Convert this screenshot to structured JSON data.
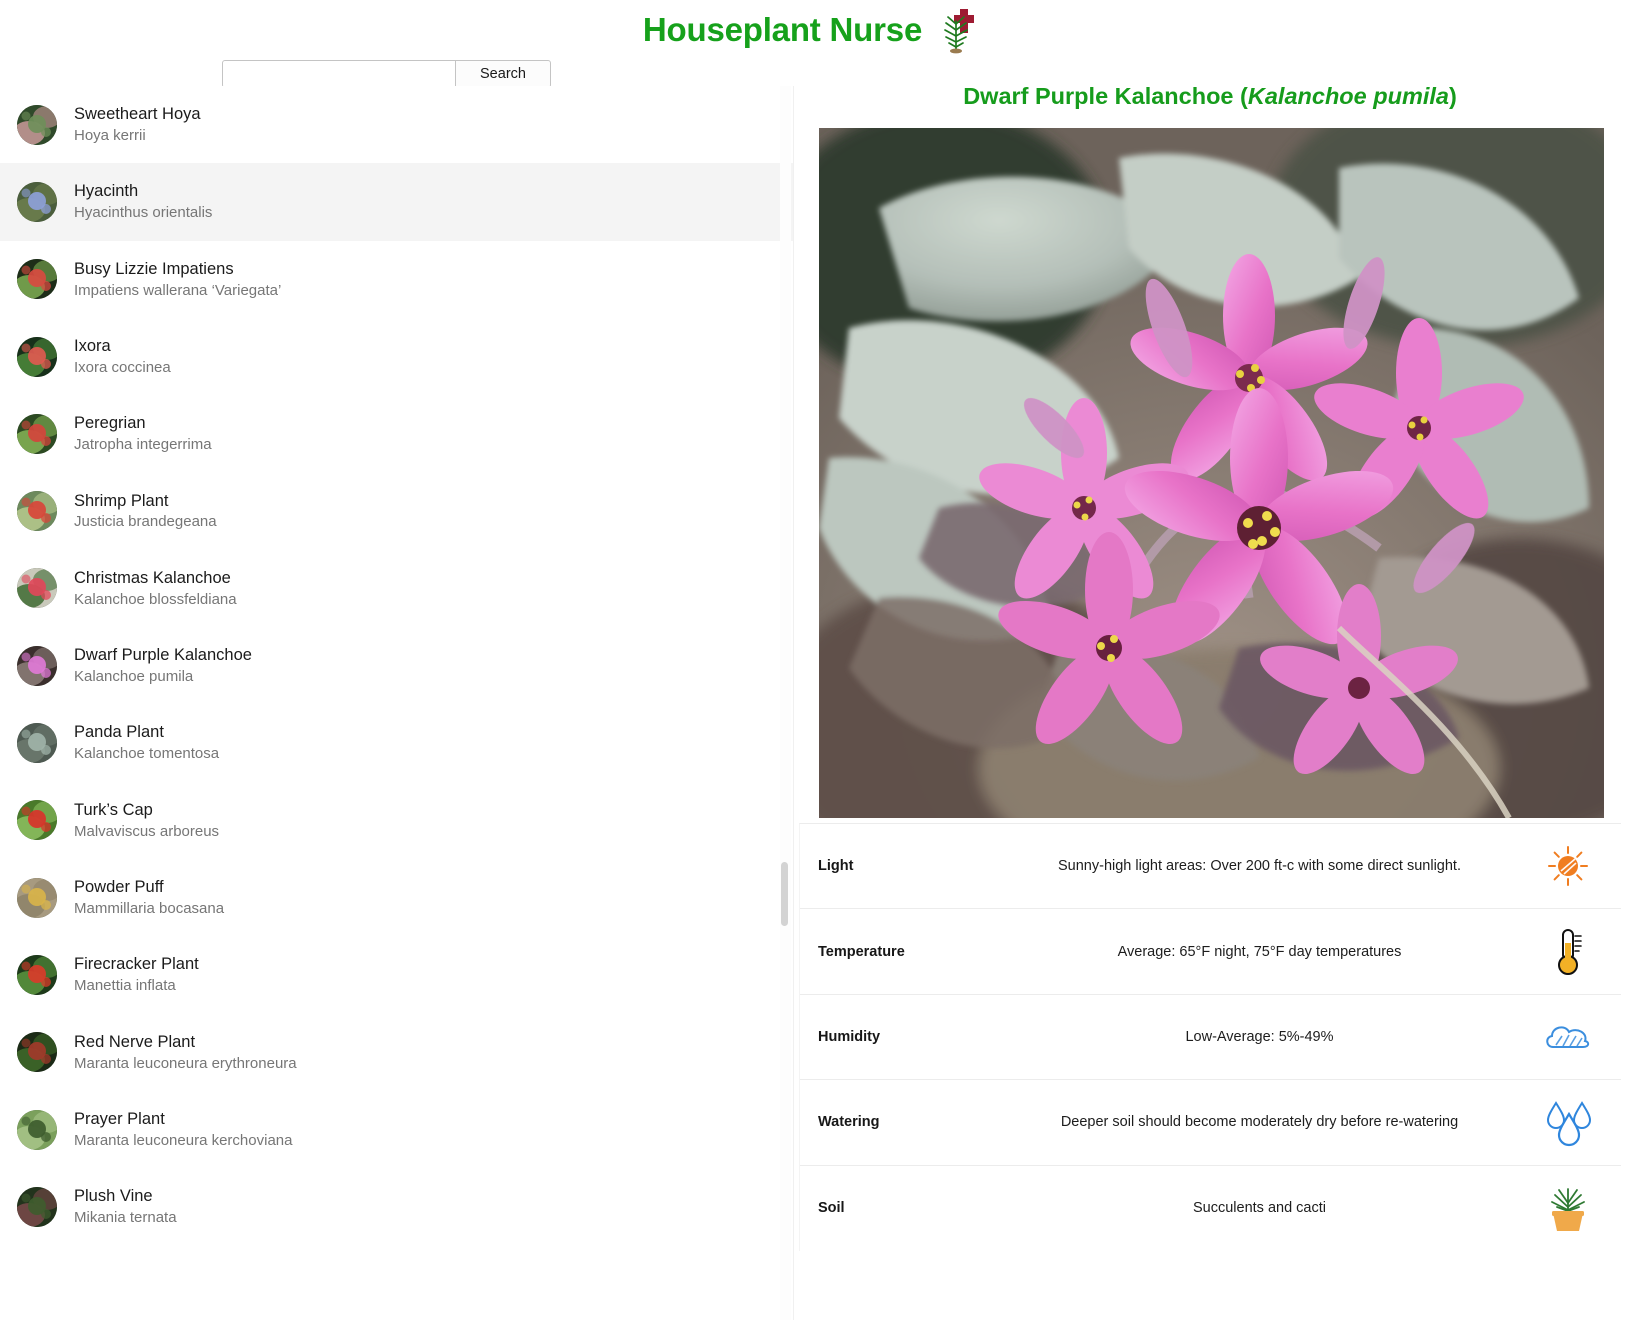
{
  "app": {
    "title": "Houseplant Nurse",
    "logo_icon": "plant-with-medical-cross-icon",
    "accent_color": "#16a11b",
    "cross_color": "#9e1b32"
  },
  "search": {
    "value": "",
    "placeholder": "",
    "button_label": "Search",
    "icon": "search-icon"
  },
  "plant_list": {
    "selected_index": 1,
    "items": [
      {
        "common_name": "Sweetheart Hoya",
        "scientific_name": "Hoya kerrii",
        "thumb_colors": [
          "#2f4a2a",
          "#6f8f5a",
          "#c99a9a"
        ]
      },
      {
        "common_name": "Hyacinth",
        "scientific_name": "Hyacinthus orientalis",
        "thumb_colors": [
          "#4b5e3c",
          "#8da0d8",
          "#6d7f4d"
        ]
      },
      {
        "common_name": "Busy Lizzie Impatiens",
        "scientific_name": "Impatiens wallerana ‘Variegata’",
        "thumb_colors": [
          "#1d2d18",
          "#d84a40",
          "#7fae54"
        ]
      },
      {
        "common_name": "Ixora",
        "scientific_name": "Ixora coccinea",
        "thumb_colors": [
          "#17301a",
          "#e05a50",
          "#4e8a3c"
        ]
      },
      {
        "common_name": "Peregrian",
        "scientific_name": "Jatropha integerrima",
        "thumb_colors": [
          "#2c4a22",
          "#d4443c",
          "#86b456"
        ]
      },
      {
        "common_name": "Shrimp Plant",
        "scientific_name": "Justicia brandegeana",
        "thumb_colors": [
          "#6d8a5d",
          "#d8453a",
          "#b7c98d"
        ]
      },
      {
        "common_name": "Christmas Kalanchoe",
        "scientific_name": "Kalanchoe blossfeldiana",
        "thumb_colors": [
          "#c9c9bb",
          "#e1485a",
          "#3f6b33"
        ]
      },
      {
        "common_name": "Dwarf Purple Kalanchoe",
        "scientific_name": "Kalanchoe pumila",
        "thumb_colors": [
          "#3a2e2c",
          "#e07ad6",
          "#8e7f7a"
        ]
      },
      {
        "common_name": "Panda Plant",
        "scientific_name": "Kalanchoe tomentosa",
        "thumb_colors": [
          "#4e5a52",
          "#9fb3a8",
          "#6d7a6f"
        ]
      },
      {
        "common_name": "Turk’s Cap",
        "scientific_name": "Malvaviscus arboreus",
        "thumb_colors": [
          "#4a7a2a",
          "#d8332a",
          "#8dc060"
        ]
      },
      {
        "common_name": "Powder Puff",
        "scientific_name": "Mammillaria bocasana",
        "thumb_colors": [
          "#a79a80",
          "#d9b44a",
          "#8d8268"
        ]
      },
      {
        "common_name": "Firecracker Plant",
        "scientific_name": "Manettia inflata",
        "thumb_colors": [
          "#1d3a1a",
          "#d93b2a",
          "#5c9640"
        ]
      },
      {
        "common_name": "Red Nerve Plant",
        "scientific_name": "Maranta leuconeura erythroneura",
        "thumb_colors": [
          "#1b2a16",
          "#a23a2a",
          "#3f6b2a"
        ]
      },
      {
        "common_name": "Prayer Plant",
        "scientific_name": "Maranta leuconeura kerchoviana",
        "thumb_colors": [
          "#7ba05c",
          "#3d5c2e",
          "#a8c488"
        ]
      },
      {
        "common_name": "Plush Vine",
        "scientific_name": "Mikania ternata",
        "thumb_colors": [
          "#22331c",
          "#3f5c2e",
          "#7a4a4a"
        ]
      }
    ]
  },
  "detail": {
    "common_name": "Dwarf Purple Kalanchoe",
    "scientific_name": "Kalanchoe pumila",
    "title_prefix": "Dwarf Purple Kalanchoe (",
    "title_suffix": ")",
    "hero_alt": "Dwarf Purple Kalanchoe pink flowers with silvery succulent leaves",
    "facts": [
      {
        "label": "Light",
        "value": "Sunny-high light areas: Over 200 ft-c with some direct sunlight.",
        "icon": "sun-icon",
        "icon_color": "#f07d20"
      },
      {
        "label": "Temperature",
        "value": "Average: 65°F night, 75°F day temperatures",
        "icon": "thermometer-icon",
        "icon_color": "#f2b126"
      },
      {
        "label": "Humidity",
        "value": "Low-Average: 5%-49%",
        "icon": "cloud-icon",
        "icon_color": "#3b8ede"
      },
      {
        "label": "Watering",
        "value": "Deeper soil should become moderately dry before re-watering",
        "icon": "water-drops-icon",
        "icon_color": "#2f86dd"
      },
      {
        "label": "Soil",
        "value": "Succulents and cacti",
        "icon": "potted-plant-icon",
        "icon_color": "#f0a94a"
      }
    ]
  },
  "scrollbar": {
    "orientation": "vertical",
    "position_percent": 63
  }
}
